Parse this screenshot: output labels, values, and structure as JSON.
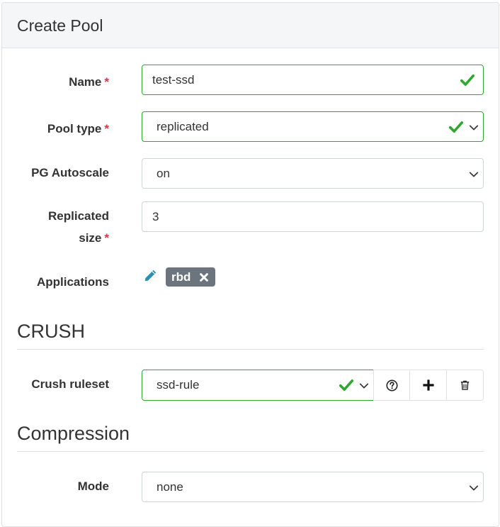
{
  "header": {
    "title": "Create Pool"
  },
  "form": {
    "name": {
      "label": "Name",
      "required_mark": "*",
      "value": "test-ssd"
    },
    "pool_type": {
      "label": "Pool type",
      "required_mark": "*",
      "value": "replicated"
    },
    "pg_autoscale": {
      "label": "PG Autoscale",
      "value": "on"
    },
    "replicated_size": {
      "label_line1": "Replicated",
      "label_line2": "size",
      "required_mark": "*",
      "value": "3"
    },
    "applications": {
      "label": "Applications",
      "badges": [
        "rbd"
      ]
    }
  },
  "crush": {
    "section_title": "CRUSH",
    "ruleset": {
      "label": "Crush ruleset",
      "value": "ssd-rule"
    }
  },
  "compression": {
    "section_title": "Compression",
    "mode": {
      "label": "Mode",
      "value": "none"
    }
  },
  "icons": {
    "valid": "check-icon",
    "dropdown": "chevron-down-icon",
    "edit": "pencil-icon",
    "remove": "x-icon",
    "help": "question-circle-icon",
    "add": "plus-icon",
    "delete": "trash-icon"
  },
  "colors": {
    "valid": "#2ea82e",
    "required": "#dc3545",
    "badge": "#6c757d"
  }
}
